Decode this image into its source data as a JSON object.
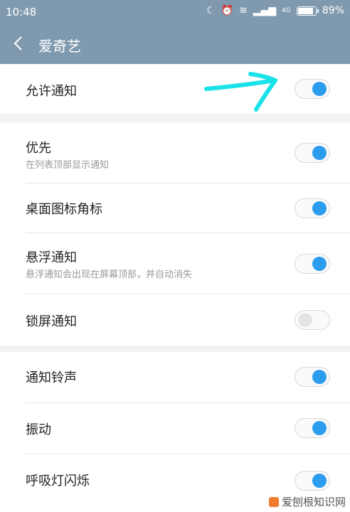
{
  "status": {
    "time": "10:48",
    "battery": "89%",
    "battery_level": 0.89,
    "network": "4G",
    "icons": [
      "moon-icon",
      "alarm-icon",
      "wifi-icon",
      "signal-icon",
      "battery-icon"
    ]
  },
  "header": {
    "back_icon": "chevron-left-icon",
    "title": "爱奇艺"
  },
  "sections": [
    {
      "rows": [
        {
          "label": "允许通知",
          "sub": "",
          "on": true
        }
      ]
    },
    {
      "rows": [
        {
          "label": "优先",
          "sub": "在列表顶部显示通知",
          "on": true
        },
        {
          "label": "桌面图标角标",
          "sub": "",
          "on": true
        },
        {
          "label": "悬浮通知",
          "sub": "悬浮通知会出现在屏幕顶部，并自动消失",
          "on": true
        },
        {
          "label": "锁屏通知",
          "sub": "",
          "on": false
        }
      ]
    },
    {
      "rows": [
        {
          "label": "通知铃声",
          "sub": "",
          "on": true
        },
        {
          "label": "振动",
          "sub": "",
          "on": true
        },
        {
          "label": "呼吸灯闪烁",
          "sub": "",
          "on": true
        }
      ]
    }
  ],
  "watermark": "爱刨根知识网",
  "colors": {
    "header": "#7f9aaf",
    "toggle_on": "#2c9cef",
    "annotation_arrow": "#19e3e8"
  }
}
